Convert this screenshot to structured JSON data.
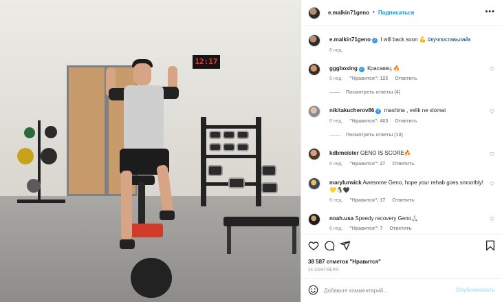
{
  "photo": {
    "alt": "",
    "clock_text": "12:17"
  },
  "header": {
    "username": "e.malkin71geno",
    "separator": "•",
    "follow_label": "Подписаться",
    "more_label": "•••"
  },
  "caption": {
    "username": "e.malkin71geno",
    "text": "I will back soon 💪 ",
    "hashtag": "#кучпоставьлайк",
    "time": "6 нед."
  },
  "comments": [
    {
      "username": "gggboxing",
      "verified": true,
      "text": "Красавец 🔥",
      "time": "6 нед.",
      "likes": "\"Нравится\": 125",
      "reply": "Ответить",
      "view_replies": "Посмотреть ответы (4)"
    },
    {
      "username": "nikitakucherov86",
      "verified": true,
      "text": "mashina , velik ne slomai",
      "time": "6 нед.",
      "likes": "\"Нравится\": 403",
      "reply": "Ответить",
      "view_replies": "Посмотреть ответы (10)"
    },
    {
      "username": "kdbmeister",
      "verified": false,
      "text": "GENO IS SCORE🔥",
      "time": "6 нед.",
      "likes": "\"Нравится\": 27",
      "reply": "Ответить"
    },
    {
      "username": "marylurwick",
      "verified": false,
      "text": "Awesome Geno, hope your rehab goes smoothly! 💛🐧🖤",
      "time": "6 нед.",
      "likes": "\"Нравится\": 17",
      "reply": "Ответить"
    },
    {
      "username": "noah.usa",
      "verified": false,
      "text": "Speedy recovery Geno🙏🏻",
      "time": "6 нед.",
      "likes": "\"Нравится\": 7",
      "reply": "Ответить"
    }
  ],
  "actions": {
    "like_icon": "heart-icon",
    "comment_icon": "comment-icon",
    "share_icon": "send-icon",
    "save_icon": "bookmark-icon",
    "likes_count": "38 587 отметок \"Нравится\"",
    "date": "24 СЕНТЯБРЯ"
  },
  "composer": {
    "placeholder": "Добавьте комментарий...",
    "publish_label": "Опубликовать"
  },
  "colors": {
    "accent": "#0095f6",
    "muted": "#8e8e8e",
    "publish_disabled": "#b2dffc"
  }
}
